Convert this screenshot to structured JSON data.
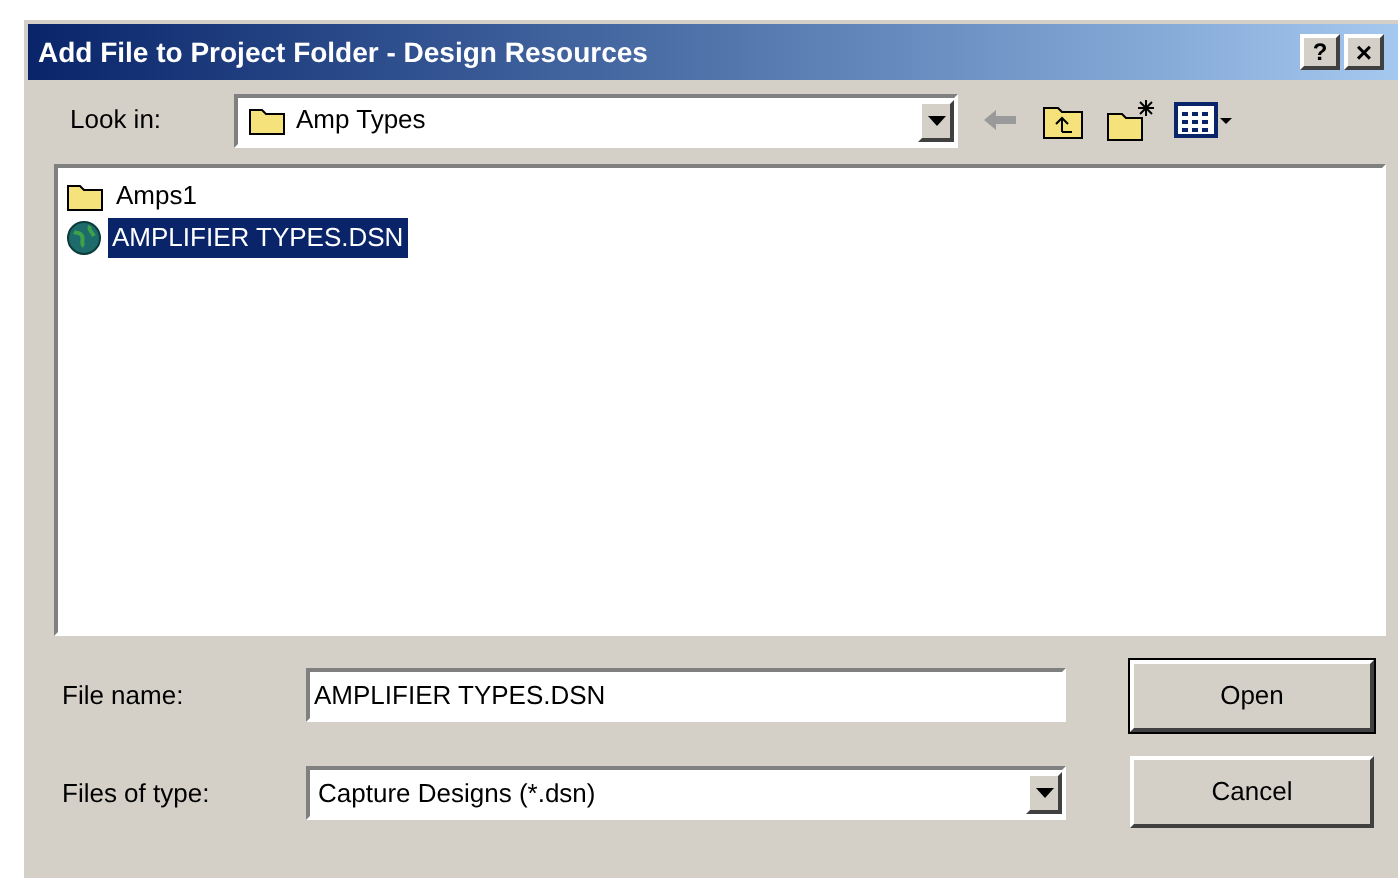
{
  "window": {
    "title": "Add File to Project Folder - Design Resources",
    "help_button": "?",
    "close_button": "×"
  },
  "look_in": {
    "label": "Look in:",
    "value": "Amp Types"
  },
  "files": [
    {
      "name": "Amps1",
      "kind": "folder",
      "selected": false
    },
    {
      "name": "AMPLIFIER TYPES.DSN",
      "kind": "design",
      "selected": true
    }
  ],
  "file_name": {
    "label": "File name:",
    "value": "AMPLIFIER TYPES.DSN"
  },
  "file_type": {
    "label": "Files of type:",
    "value": "Capture Designs (*.dsn)"
  },
  "buttons": [
    {
      "label": "Open",
      "default": true
    },
    {
      "label": "Cancel",
      "default": false
    }
  ]
}
